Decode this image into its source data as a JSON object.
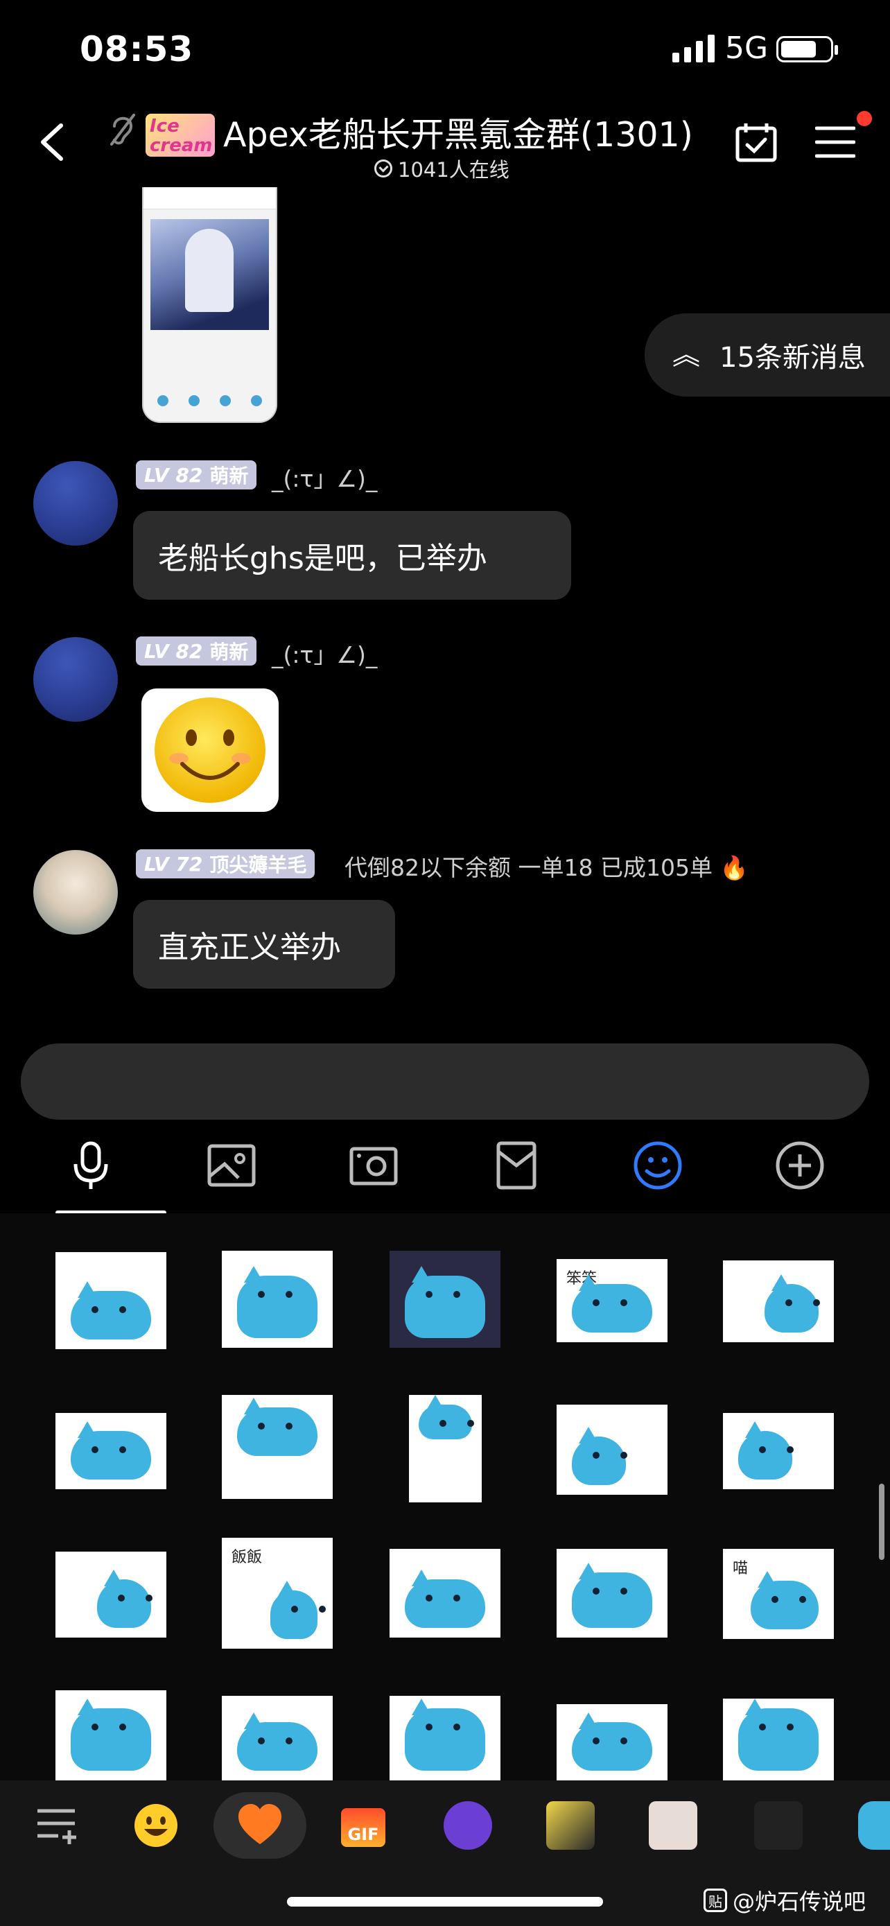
{
  "status_bar": {
    "time": "08:53",
    "network": "5G"
  },
  "header": {
    "logo_text": "Ice cream",
    "title": "Apex老船长开黑氪金群(1301)",
    "online": "1041人在线"
  },
  "new_messages": "15条新消息",
  "messages": [
    {
      "level": "LV 82",
      "title": "萌新",
      "nickname": "_(:τ」∠)_",
      "text": "老船长ghs是吧，已举办"
    },
    {
      "level": "LV 82",
      "title": "萌新",
      "nickname": "_(:τ」∠)_",
      "sticker": "smiley-face"
    },
    {
      "level": "LV 72",
      "title": "顶尖薅羊毛",
      "nickname": "代倒82以下余额 一单18 已成105单 🔥",
      "text": "直充正义举办"
    }
  ],
  "toolbar": [
    "microphone-icon",
    "image-icon",
    "camera-icon",
    "red-packet-icon",
    "emoji-icon",
    "plus-icon"
  ],
  "sticker_texts": {
    "s4": "笨笨",
    "s12": "飯飯",
    "s15": "喵"
  },
  "bottom_bar": {
    "gif_label": "GIF"
  },
  "watermark": {
    "icon": "贴",
    "text": "@炉石传说吧"
  },
  "colors": {
    "background": "#000000",
    "bubble": "#2c2c2c",
    "badge": "#c4c7de",
    "accent": "#2f7bff",
    "heart": "#ff7a21",
    "cat": "#3fb4e0"
  }
}
